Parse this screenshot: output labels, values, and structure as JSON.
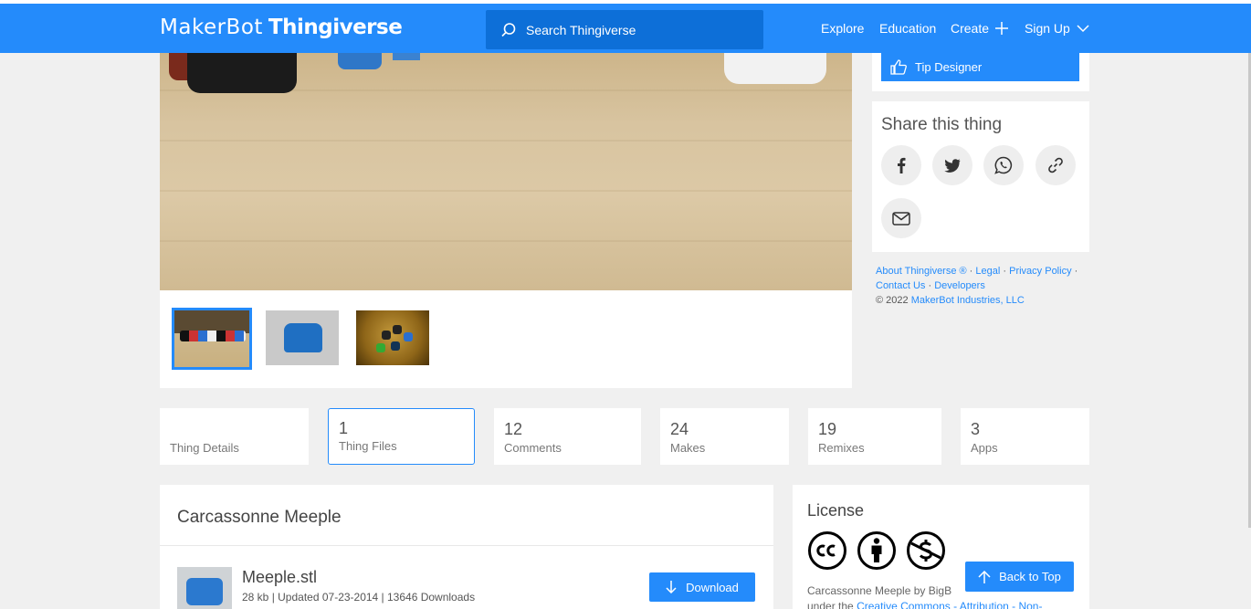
{
  "header": {
    "logo_prefix": "MakerBot",
    "logo_name": "Thingiverse",
    "search_placeholder": "Search Thingiverse",
    "nav": {
      "explore": "Explore",
      "education": "Education",
      "create": "Create",
      "signup": "Sign Up"
    }
  },
  "gallery": {
    "thumbnails": [
      "thumbnail-1",
      "thumbnail-2",
      "thumbnail-3"
    ],
    "selected_index": 0
  },
  "sidebar": {
    "tip_designer": "Tip Designer",
    "share_title": "Share this thing",
    "share_icons": [
      "facebook-icon",
      "twitter-icon",
      "whatsapp-icon",
      "link-icon",
      "email-icon"
    ]
  },
  "footer": {
    "about": "About Thingiverse ®",
    "legal": "Legal",
    "privacy": "Privacy Policy",
    "contact": "Contact Us",
    "developers": "Developers",
    "copyright": "© 2022",
    "company": "MakerBot Industries, LLC"
  },
  "tabs": [
    {
      "num": "",
      "label": "Thing Details"
    },
    {
      "num": "1",
      "label": "Thing Files"
    },
    {
      "num": "12",
      "label": "Comments"
    },
    {
      "num": "24",
      "label": "Makes"
    },
    {
      "num": "19",
      "label": "Remixes"
    },
    {
      "num": "3",
      "label": "Apps"
    }
  ],
  "files": {
    "title": "Carcassonne Meeple",
    "items": [
      {
        "name": "Meeple.stl",
        "meta": "28 kb | Updated 07-23-2014 | 13646 Downloads",
        "button": "Download"
      }
    ]
  },
  "license": {
    "title": "License",
    "icons": [
      "cc-icon",
      "attribution-icon",
      "noncommercial-icon"
    ],
    "text_line1": "Carcassonne Meeple by BigB",
    "text_line2_prefix": "under the",
    "text_line2_link": "Creative Commons - Attribution - Non-"
  },
  "back_to_top": "Back to Top",
  "colors": {
    "brand_blue": "#248bfb",
    "search_bg": "#0d6fd8",
    "page_bg": "#f0f0f0"
  }
}
